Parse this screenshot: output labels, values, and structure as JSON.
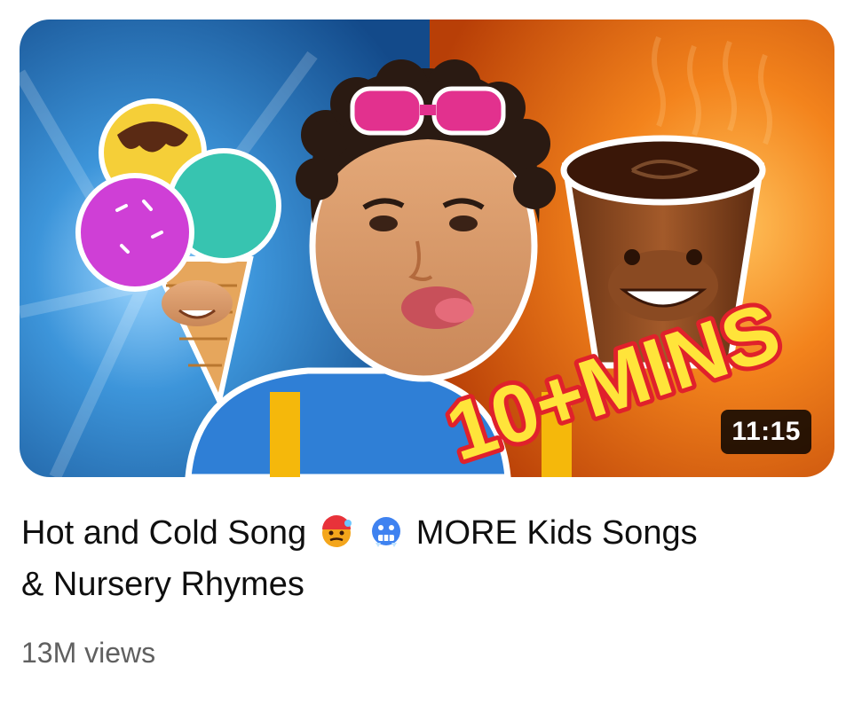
{
  "video": {
    "duration": "11:15",
    "overlay_text": "10+MINS",
    "title_part1": "Hot and Cold Song",
    "emoji1": "hot-face-emoji",
    "emoji2": "cold-face-emoji",
    "title_part2": "MORE Kids Songs",
    "title_part3": "& Nursery Rhymes",
    "views": "13M views"
  },
  "colors": {
    "left_background": "#1f6fb8",
    "right_background": "#e86a12",
    "overlay_text": "#ffe43a",
    "overlay_outline": "#e0212b",
    "duration_bg": "#000000"
  }
}
